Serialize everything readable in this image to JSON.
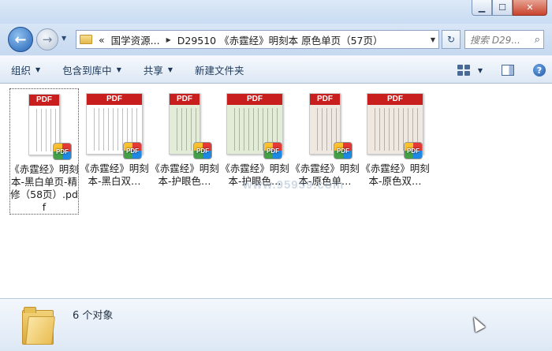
{
  "window": {
    "min_glyph": "▁",
    "max_glyph": "☐",
    "close_glyph": "✕"
  },
  "nav": {
    "back_glyph": "←",
    "forward_glyph": "→",
    "history_glyph": "▼",
    "address_prefix": "«",
    "breadcrumb": [
      "国学资源...",
      "D29510 《赤霆经》明刻本 原色单页（57页）"
    ],
    "breadcrumb_sep": "▶",
    "address_drop": "▼",
    "refresh_glyph": "↻",
    "search_placeholder": "搜索 D29...",
    "search_glyph": "⌕"
  },
  "toolbar": {
    "organize": "组织",
    "include_library": "包含到库中",
    "share": "共享",
    "new_folder": "新建文件夹",
    "arrow": "▼",
    "help_glyph": "?"
  },
  "files": [
    {
      "name": "《赤霆经》明刻本-黑白单页-精修（58页）.pdf",
      "thumb_label": "PDF",
      "badge": "PDF",
      "tone": "white",
      "shape": "portrait",
      "selected": true
    },
    {
      "name": "《赤霆经》明刻本-黑白双…",
      "thumb_label": "PDF",
      "badge": "PDF",
      "tone": "white",
      "shape": "landscape",
      "selected": false
    },
    {
      "name": "《赤霆经》明刻本-护眼色…",
      "thumb_label": "PDF",
      "badge": "PDF",
      "tone": "green",
      "shape": "portrait",
      "selected": false
    },
    {
      "name": "《赤霆经》明刻本-护眼色…",
      "thumb_label": "PDF",
      "badge": "PDF",
      "tone": "green",
      "shape": "landscape",
      "selected": false
    },
    {
      "name": "《赤霆经》明刻本-原色单…",
      "thumb_label": "PDF",
      "badge": "PDF",
      "tone": "aged",
      "shape": "portrait",
      "selected": false
    },
    {
      "name": "《赤霆经》明刻本-原色双…",
      "thumb_label": "PDF",
      "badge": "PDF",
      "tone": "aged",
      "shape": "landscape",
      "selected": false
    }
  ],
  "watermark": "www.95959.com",
  "details": {
    "item_count": "6 个对象"
  },
  "colors": {
    "pdf_red": "#c81e1e",
    "toolbar_text": "#1e395b"
  }
}
